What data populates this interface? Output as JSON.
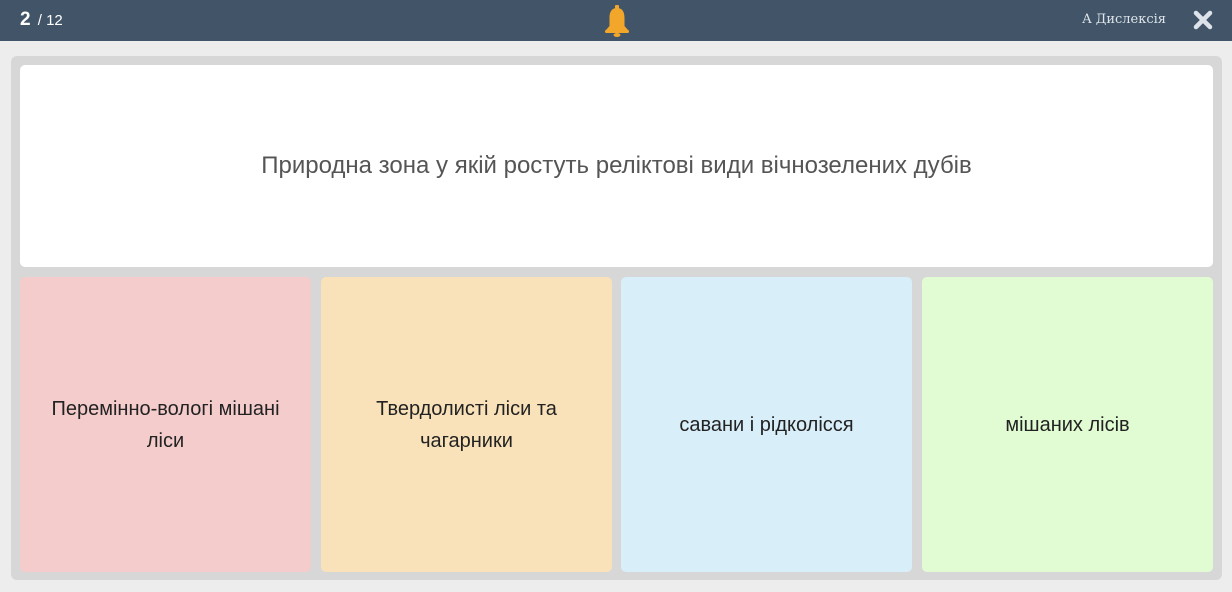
{
  "header": {
    "current_question": "2",
    "total_questions": "/ 12",
    "dyslexia_label": "A Дислексія"
  },
  "question": {
    "text": "Природна зона у якій ростуть реліктові види вічнозелених дубів"
  },
  "answers": [
    {
      "label": "Перемінно-вологі мішані ліси",
      "color": "#f5cccc"
    },
    {
      "label": "Твердолисті ліси та чагарники",
      "color": "#f9e2b9"
    },
    {
      "label": "савани і рідколісся",
      "color": "#d8eef9"
    },
    {
      "label": "мішаних лісів",
      "color": "#e1fcd2"
    }
  ],
  "colors": {
    "header_bg": "#415468",
    "bell": "#f2a72a",
    "board_bg": "#d7d7d7",
    "page_bg": "#ededed"
  },
  "icons": {
    "bell": "bell-icon",
    "close": "close-icon"
  }
}
